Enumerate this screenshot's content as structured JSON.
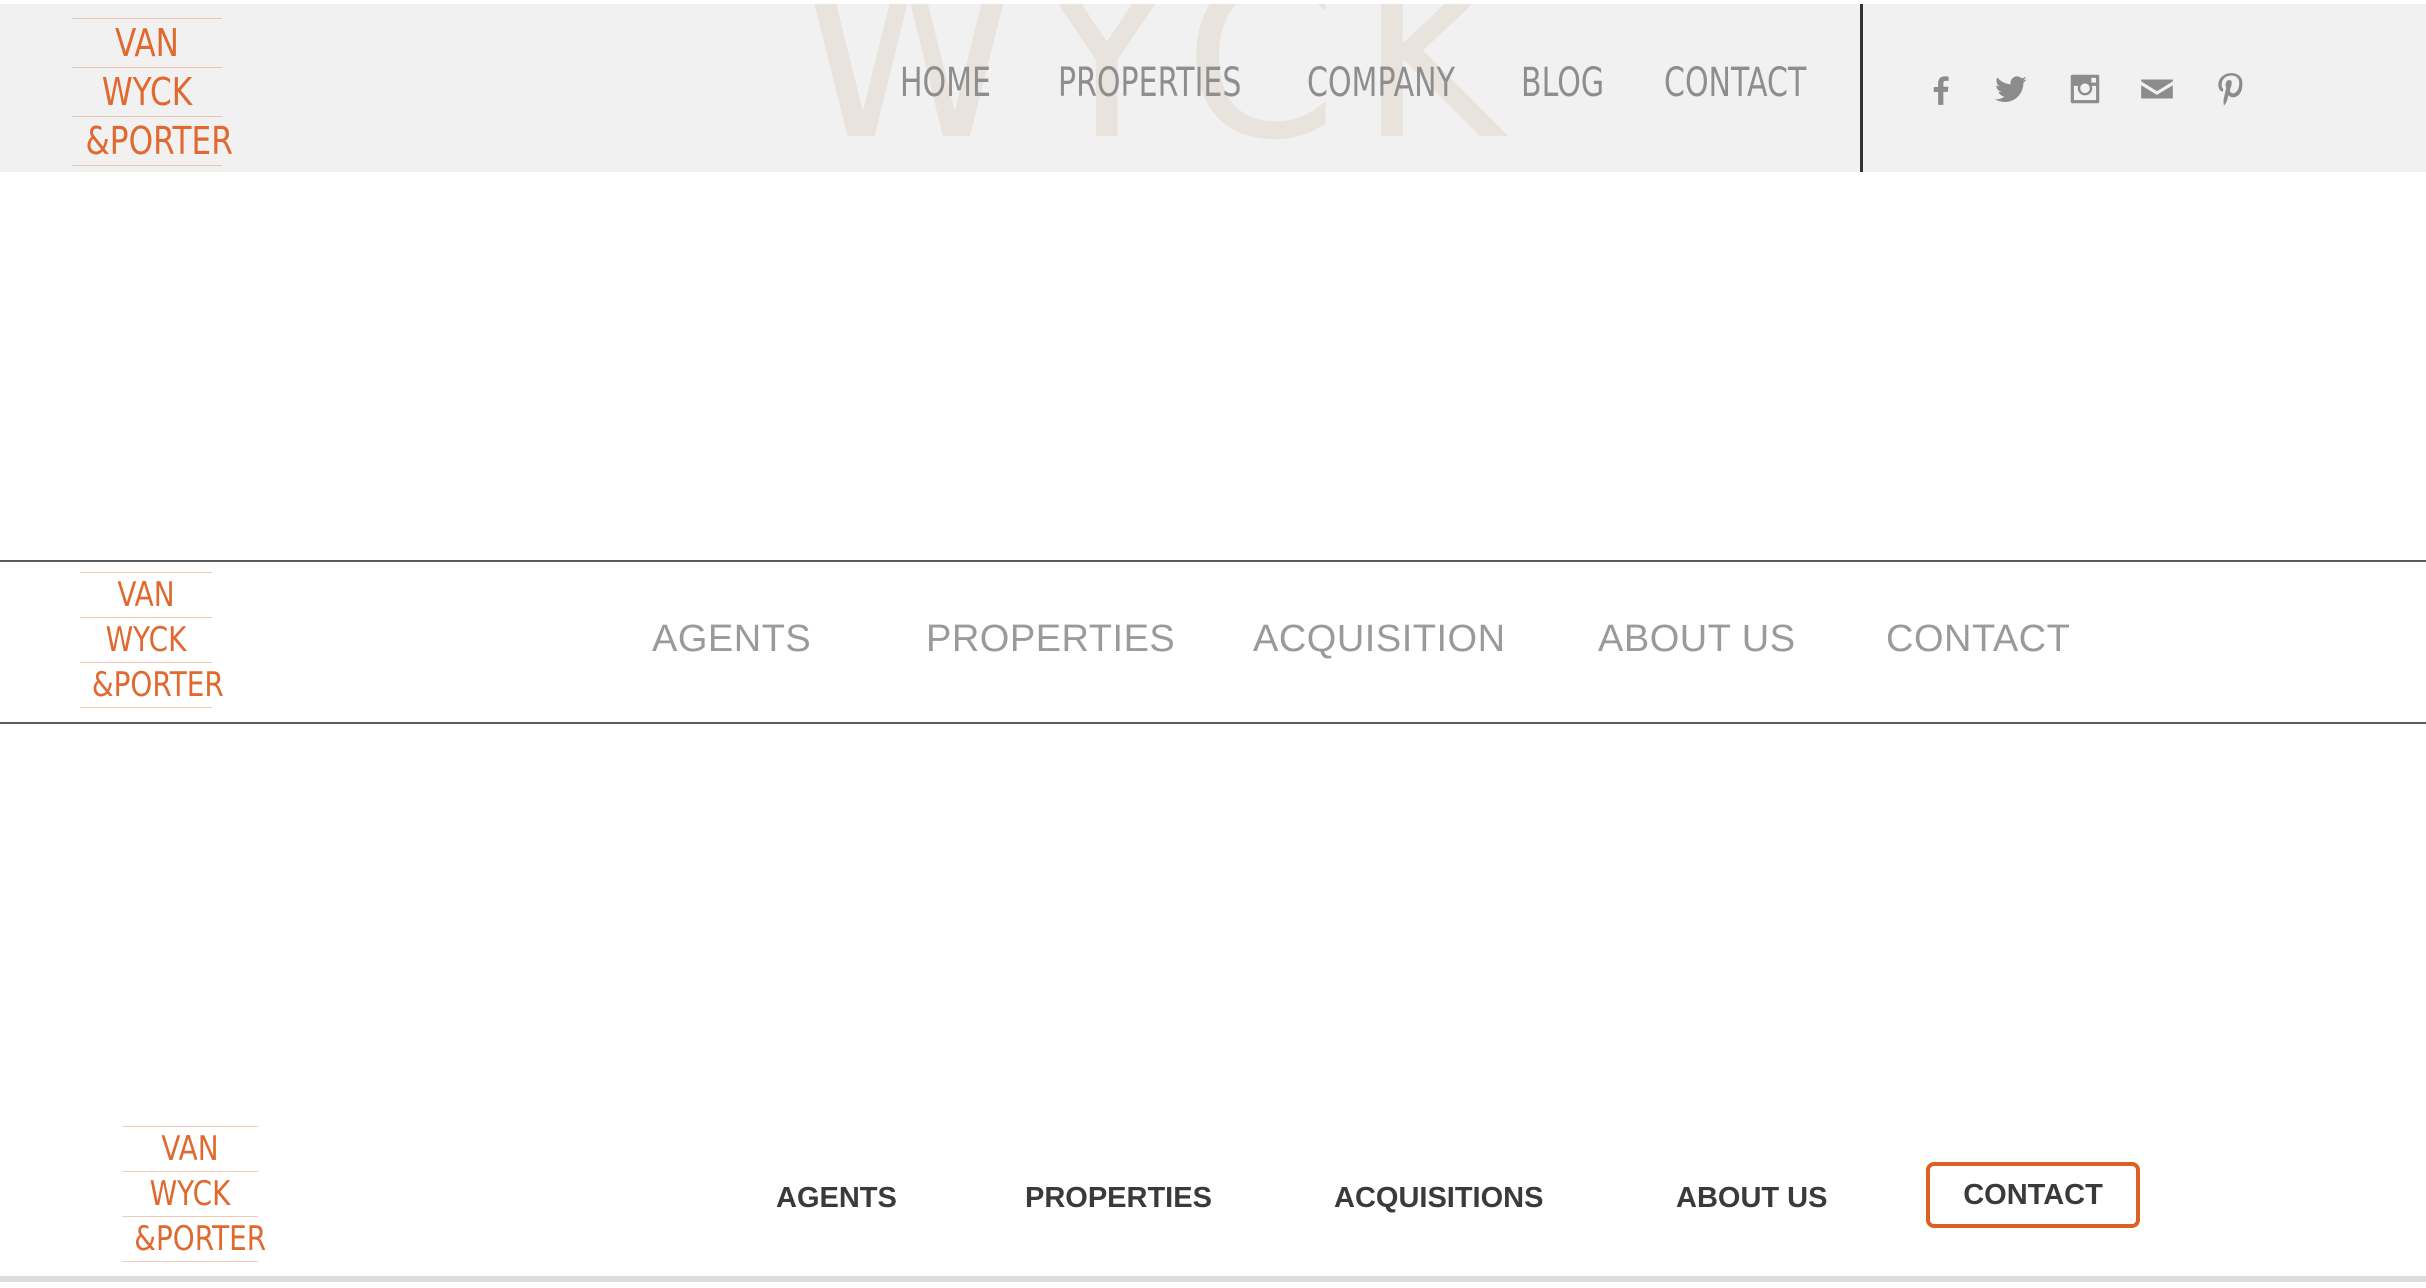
{
  "brand": {
    "logo_lines": [
      "VAN",
      "WYCK",
      "&PORTER"
    ],
    "accent_color": "#e0692f"
  },
  "header_v1": {
    "watermark_text": "WYCK",
    "nav": [
      "HOME",
      "PROPERTIES",
      "COMPANY",
      "BLOG",
      "CONTACT"
    ],
    "social_icons": [
      "facebook-icon",
      "twitter-icon",
      "instagram-icon",
      "mail-icon",
      "pinterest-icon"
    ]
  },
  "header_v2": {
    "nav": [
      "AGENTS",
      "PROPERTIES",
      "ACQUISITION",
      "ABOUT US",
      "CONTACT"
    ]
  },
  "header_v3": {
    "nav": [
      "AGENTS",
      "PROPERTIES",
      "ACQUISITIONS",
      "ABOUT US"
    ],
    "cta_label": "CONTACT",
    "cta_border_color": "#dd5f22"
  }
}
